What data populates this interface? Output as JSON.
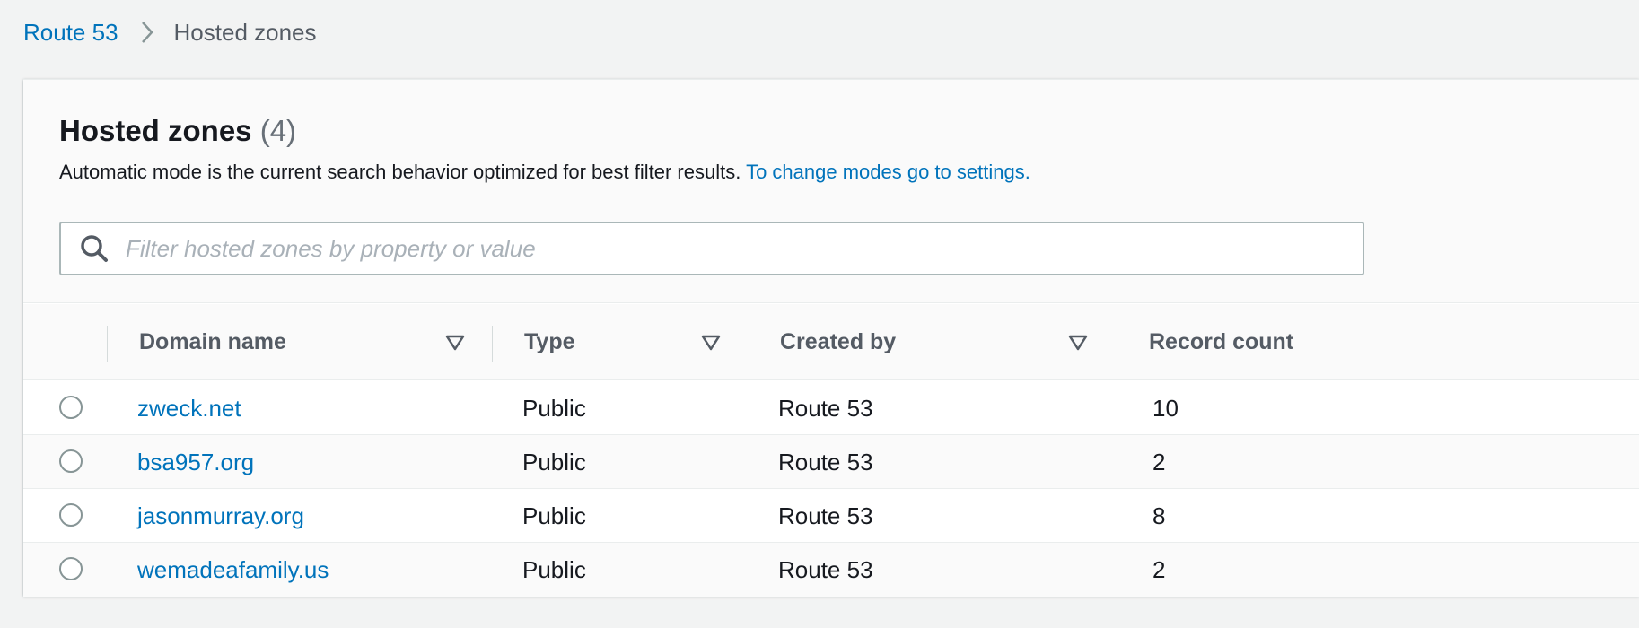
{
  "breadcrumb": {
    "root": "Route 53",
    "current": "Hosted zones"
  },
  "panel": {
    "title": "Hosted zones",
    "count": "(4)",
    "description": "Automatic mode is the current search behavior optimized for best filter results.",
    "settings_link": "To change modes go to settings."
  },
  "search": {
    "placeholder": "Filter hosted zones by property or value",
    "value": ""
  },
  "table": {
    "columns": [
      "Domain name",
      "Type",
      "Created by",
      "Record count"
    ],
    "rows": [
      {
        "domain": "zweck.net",
        "type": "Public",
        "created_by": "Route 53",
        "record_count": "10"
      },
      {
        "domain": "bsa957.org",
        "type": "Public",
        "created_by": "Route 53",
        "record_count": "2"
      },
      {
        "domain": "jasonmurray.org",
        "type": "Public",
        "created_by": "Route 53",
        "record_count": "8"
      },
      {
        "domain": "wemadeafamily.us",
        "type": "Public",
        "created_by": "Route 53",
        "record_count": "2"
      }
    ]
  },
  "icons": {
    "breadcrumb_separator": "chevron-right-icon",
    "search": "search-icon",
    "sort": "sort-caret-down-icon"
  },
  "colors": {
    "link": "#0073bb",
    "background": "#f2f3f3",
    "text": "#16191f",
    "muted": "#545b64"
  }
}
